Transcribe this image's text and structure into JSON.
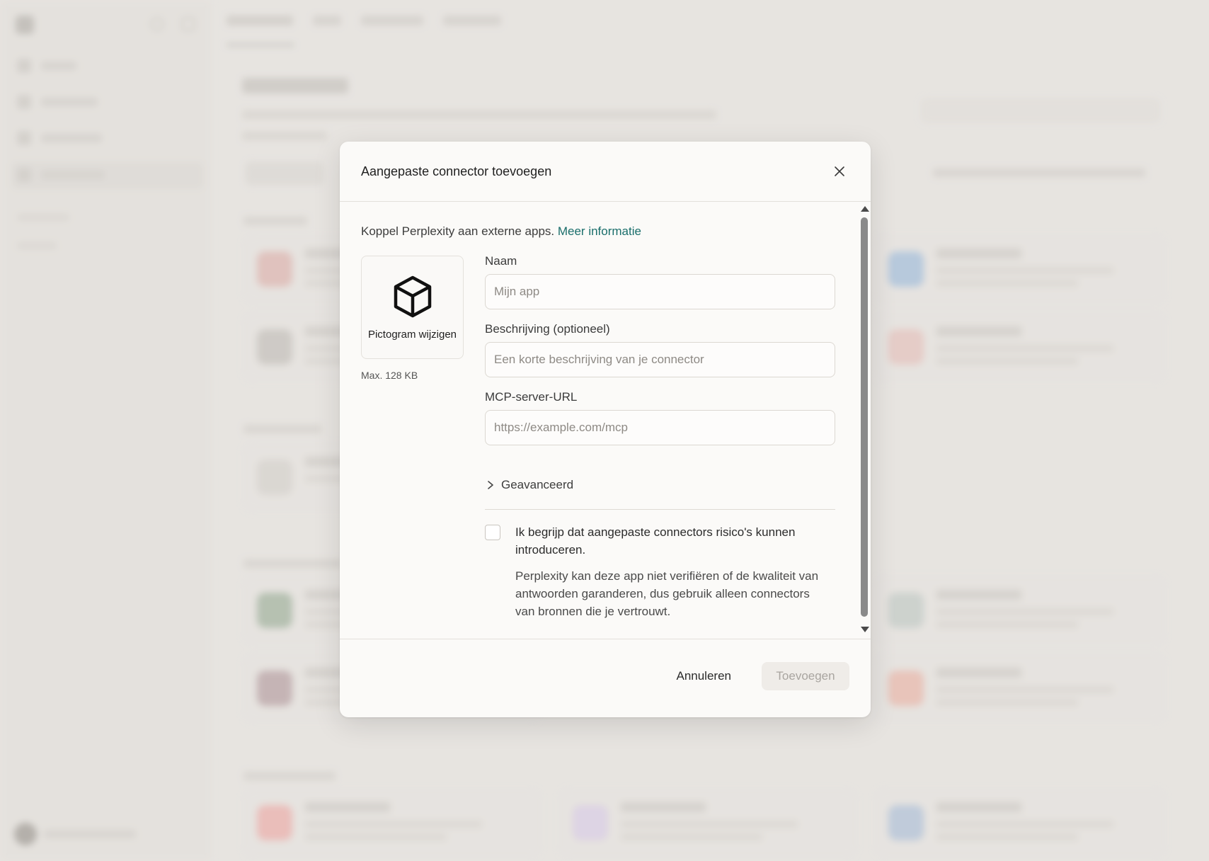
{
  "modal": {
    "title": "Aangepaste connector toevoegen",
    "intro": "Koppel Perplexity aan externe apps.",
    "intro_link": "Meer informatie",
    "icon_change_label": "Pictogram wijzigen",
    "icon_max_size": "Max. 128 KB",
    "fields": {
      "name_label": "Naam",
      "name_placeholder": "Mijn app",
      "description_label": "Beschrijving (optioneel)",
      "description_placeholder": "Een korte beschrijving van je connector",
      "url_label": "MCP-server-URL",
      "url_placeholder": "https://example.com/mcp"
    },
    "advanced_label": "Geavanceerd",
    "consent_text": "Ik begrijp dat aangepaste connectors risico's kunnen introduceren.",
    "consent_note": "Perplexity kan deze app niet verifiëren of de kwaliteit van antwoorden garanderen, dus gebruik alleen connectors van bronnen die je vertrouwt.",
    "cancel_label": "Annuleren",
    "add_label": "Toevoegen"
  },
  "colors": {
    "link": "#1a6e6b",
    "modal_bg": "#fbfaf8",
    "page_bg": "#e5e2de",
    "disabled_button_bg": "#efece8"
  }
}
